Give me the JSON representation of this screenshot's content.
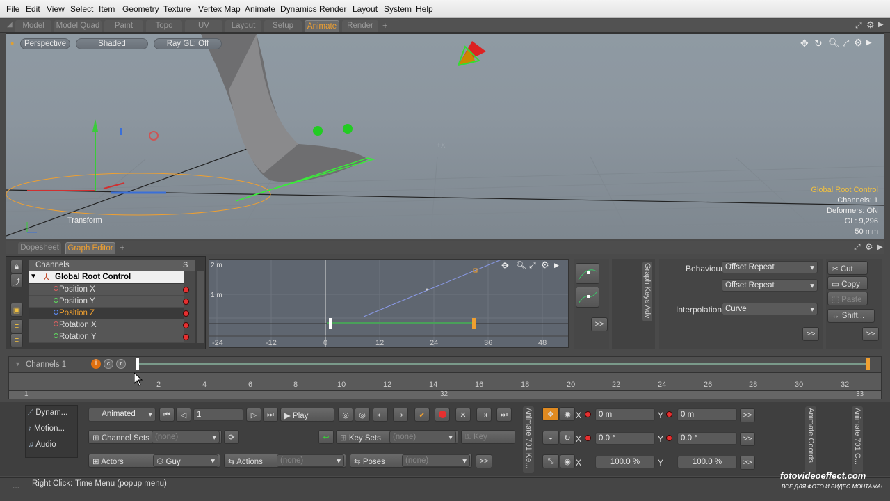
{
  "menu": [
    "File",
    "Edit",
    "View",
    "Select",
    "Item",
    "Geometry",
    "Texture",
    "Vertex Map",
    "Animate",
    "Dynamics",
    "Render",
    "Layout",
    "System",
    "Help"
  ],
  "layout_tabs": [
    "Model",
    "Model Quad",
    "Paint",
    "Topo",
    "UV",
    "Layout",
    "Setup",
    "Animate",
    "Render"
  ],
  "active_layout_tab": "Animate",
  "viewport": {
    "view_mode": "Perspective",
    "shading": "Shaded",
    "raygl": "Ray GL: Off",
    "transform_label": "Transform",
    "axis_label": "+X",
    "info": {
      "selection": "Global Root Control",
      "channels": "Channels: 1",
      "deformers": "Deformers: ON",
      "gl": "GL: 9,296",
      "lens": "50 mm"
    }
  },
  "graph_tabs": [
    "Dopesheet",
    "Graph Editor"
  ],
  "active_graph_tab": "Graph Editor",
  "channels": {
    "header": "Channels",
    "col_s": "S",
    "root": "Global Root Control",
    "items": [
      "Position X",
      "Position Y",
      "Position Z",
      "Rotation X",
      "Rotation Y"
    ],
    "selected": "Position Z"
  },
  "graph": {
    "y_labels": [
      "2 m",
      "1 m"
    ],
    "x_ticks": [
      "-24",
      "-12",
      "0",
      "12",
      "24",
      "36",
      "48"
    ]
  },
  "graph_side": {
    "more": ">>",
    "vtitle": "Graph Keys Adv"
  },
  "props": {
    "behaviour_label": "Behaviour",
    "behaviour_pre": "Offset Repeat",
    "behaviour_post": "Offset Repeat",
    "interp_label": "Interpolation",
    "interp_value": "Curve",
    "more": ">>"
  },
  "edit": {
    "cut": "Cut",
    "copy": "Copy",
    "paste": "Paste",
    "shift": "Shift...",
    "more": ">>"
  },
  "timeline": {
    "label": "Channels 1",
    "ticks": [
      "2",
      "4",
      "6",
      "8",
      "10",
      "12",
      "14",
      "16",
      "18",
      "20",
      "22",
      "24",
      "26",
      "28",
      "30",
      "32"
    ],
    "range_start": "1",
    "range_mid": "32",
    "range_end": "33"
  },
  "bottom": {
    "left_items": [
      "Dynam...",
      "Motion...",
      "Audio"
    ],
    "animated": "Animated",
    "frame": "1",
    "play": "Play",
    "channel_sets": "Channel Sets",
    "none": "(none)",
    "key_sets": "Key Sets",
    "key": "Key",
    "actors": "Actors",
    "guy": "Guy",
    "actions": "Actions",
    "poses": "Poses",
    "more": ">>",
    "vtab1": "Animate 701 Ke...",
    "coords_pos_x": "0 m",
    "coords_pos_y": "0 m",
    "coords_rot_x": "0.0 °",
    "coords_rot_y": "0.0 °",
    "coords_scl_x": "100.0 %",
    "coords_scl_y": "100.0 %",
    "x_label": "X",
    "y_label": "Y",
    "vtab2": "Animate Coords",
    "vtab3": "Animate 701 C..."
  },
  "status": {
    "dots": "...",
    "label": "Right Click:",
    "text": "Time Menu (popup menu)"
  },
  "watermark": {
    "site": "fotovideoeffect.com",
    "tagline": "ВСЕ ДЛЯ ФОТО И ВИДЕО МОНТАЖА!"
  },
  "colors": {
    "accent": "#f0a030",
    "key": "#e63030"
  }
}
